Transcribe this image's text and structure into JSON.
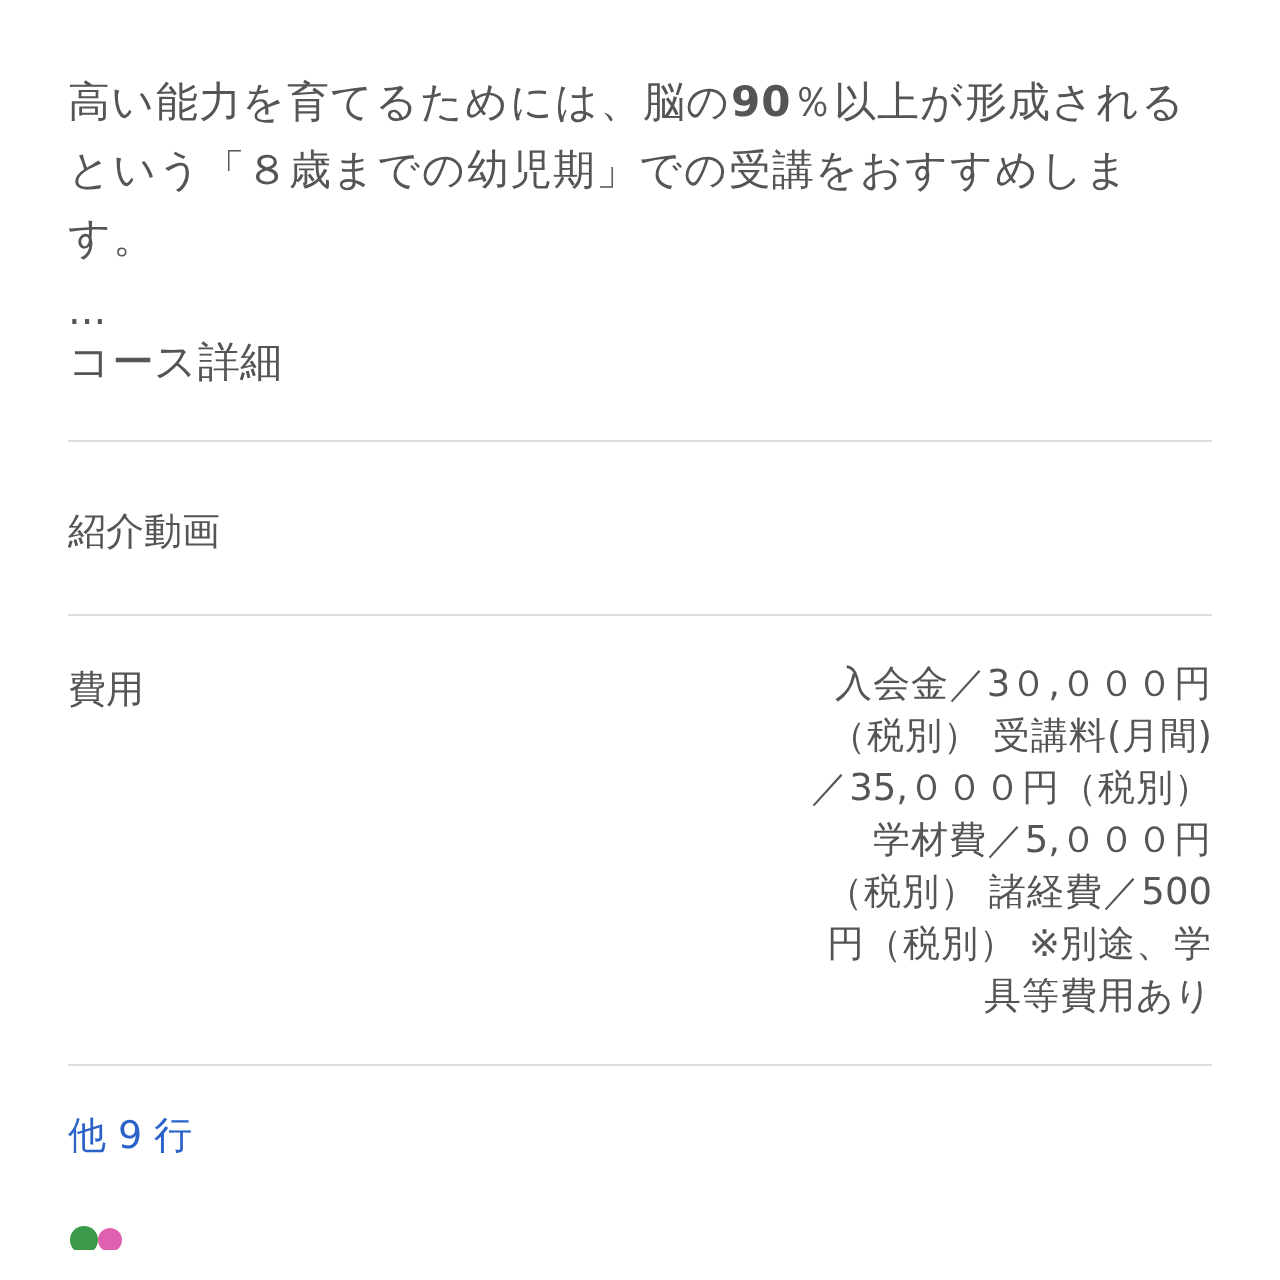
{
  "description": {
    "text": "高い能力を育てるためには、脳の**90**％以上が形成されるという「８歳までの幼児期」での受講をおすすめします。",
    "ellipsis": "...",
    "detail_link": "コース詳細"
  },
  "rows": [
    {
      "label": "紹介動画"
    },
    {
      "label": "費用",
      "value_lines": [
        "入会金／3０,０００円",
        "（税別） 受講料(月間)",
        "／35,０００円（税別）",
        "学材費／5,０００円",
        "（税別） 諸経費／500",
        "円（税別） ※別途、学",
        "具等費用あり"
      ]
    }
  ],
  "more_link": "他 9 行"
}
